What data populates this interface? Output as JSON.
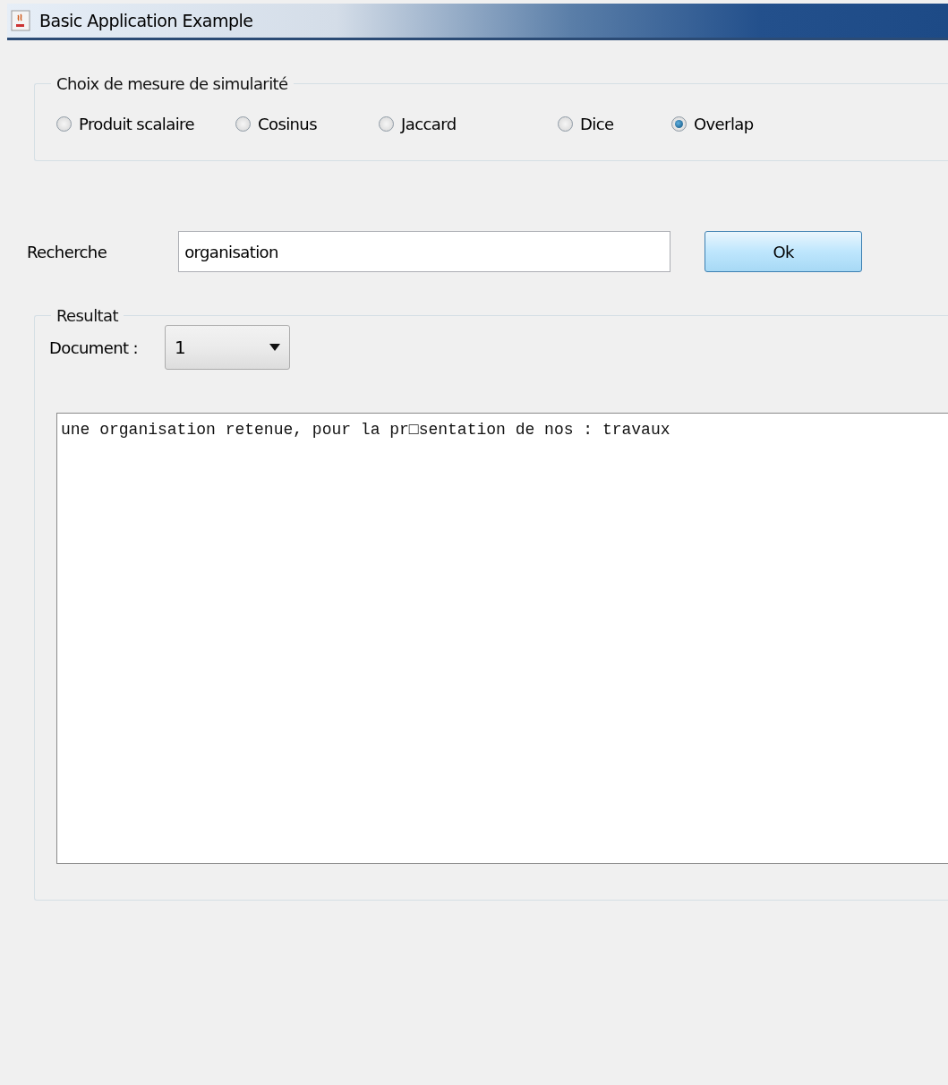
{
  "window": {
    "title": "Basic Application Example"
  },
  "similarity": {
    "legend": "Choix de mesure de simularité",
    "options": [
      {
        "label": "Produit scalaire",
        "selected": false
      },
      {
        "label": "Cosinus",
        "selected": false
      },
      {
        "label": "Jaccard",
        "selected": false
      },
      {
        "label": "Dice",
        "selected": false
      },
      {
        "label": "Overlap",
        "selected": true
      }
    ]
  },
  "search": {
    "label": "Recherche",
    "value": "organisation",
    "button": "Ok"
  },
  "result": {
    "legend": "Resultat",
    "document_label": "Document :",
    "document_value": "1",
    "text": "une organisation retenue, pour la pr□sentation de nos : travaux"
  }
}
